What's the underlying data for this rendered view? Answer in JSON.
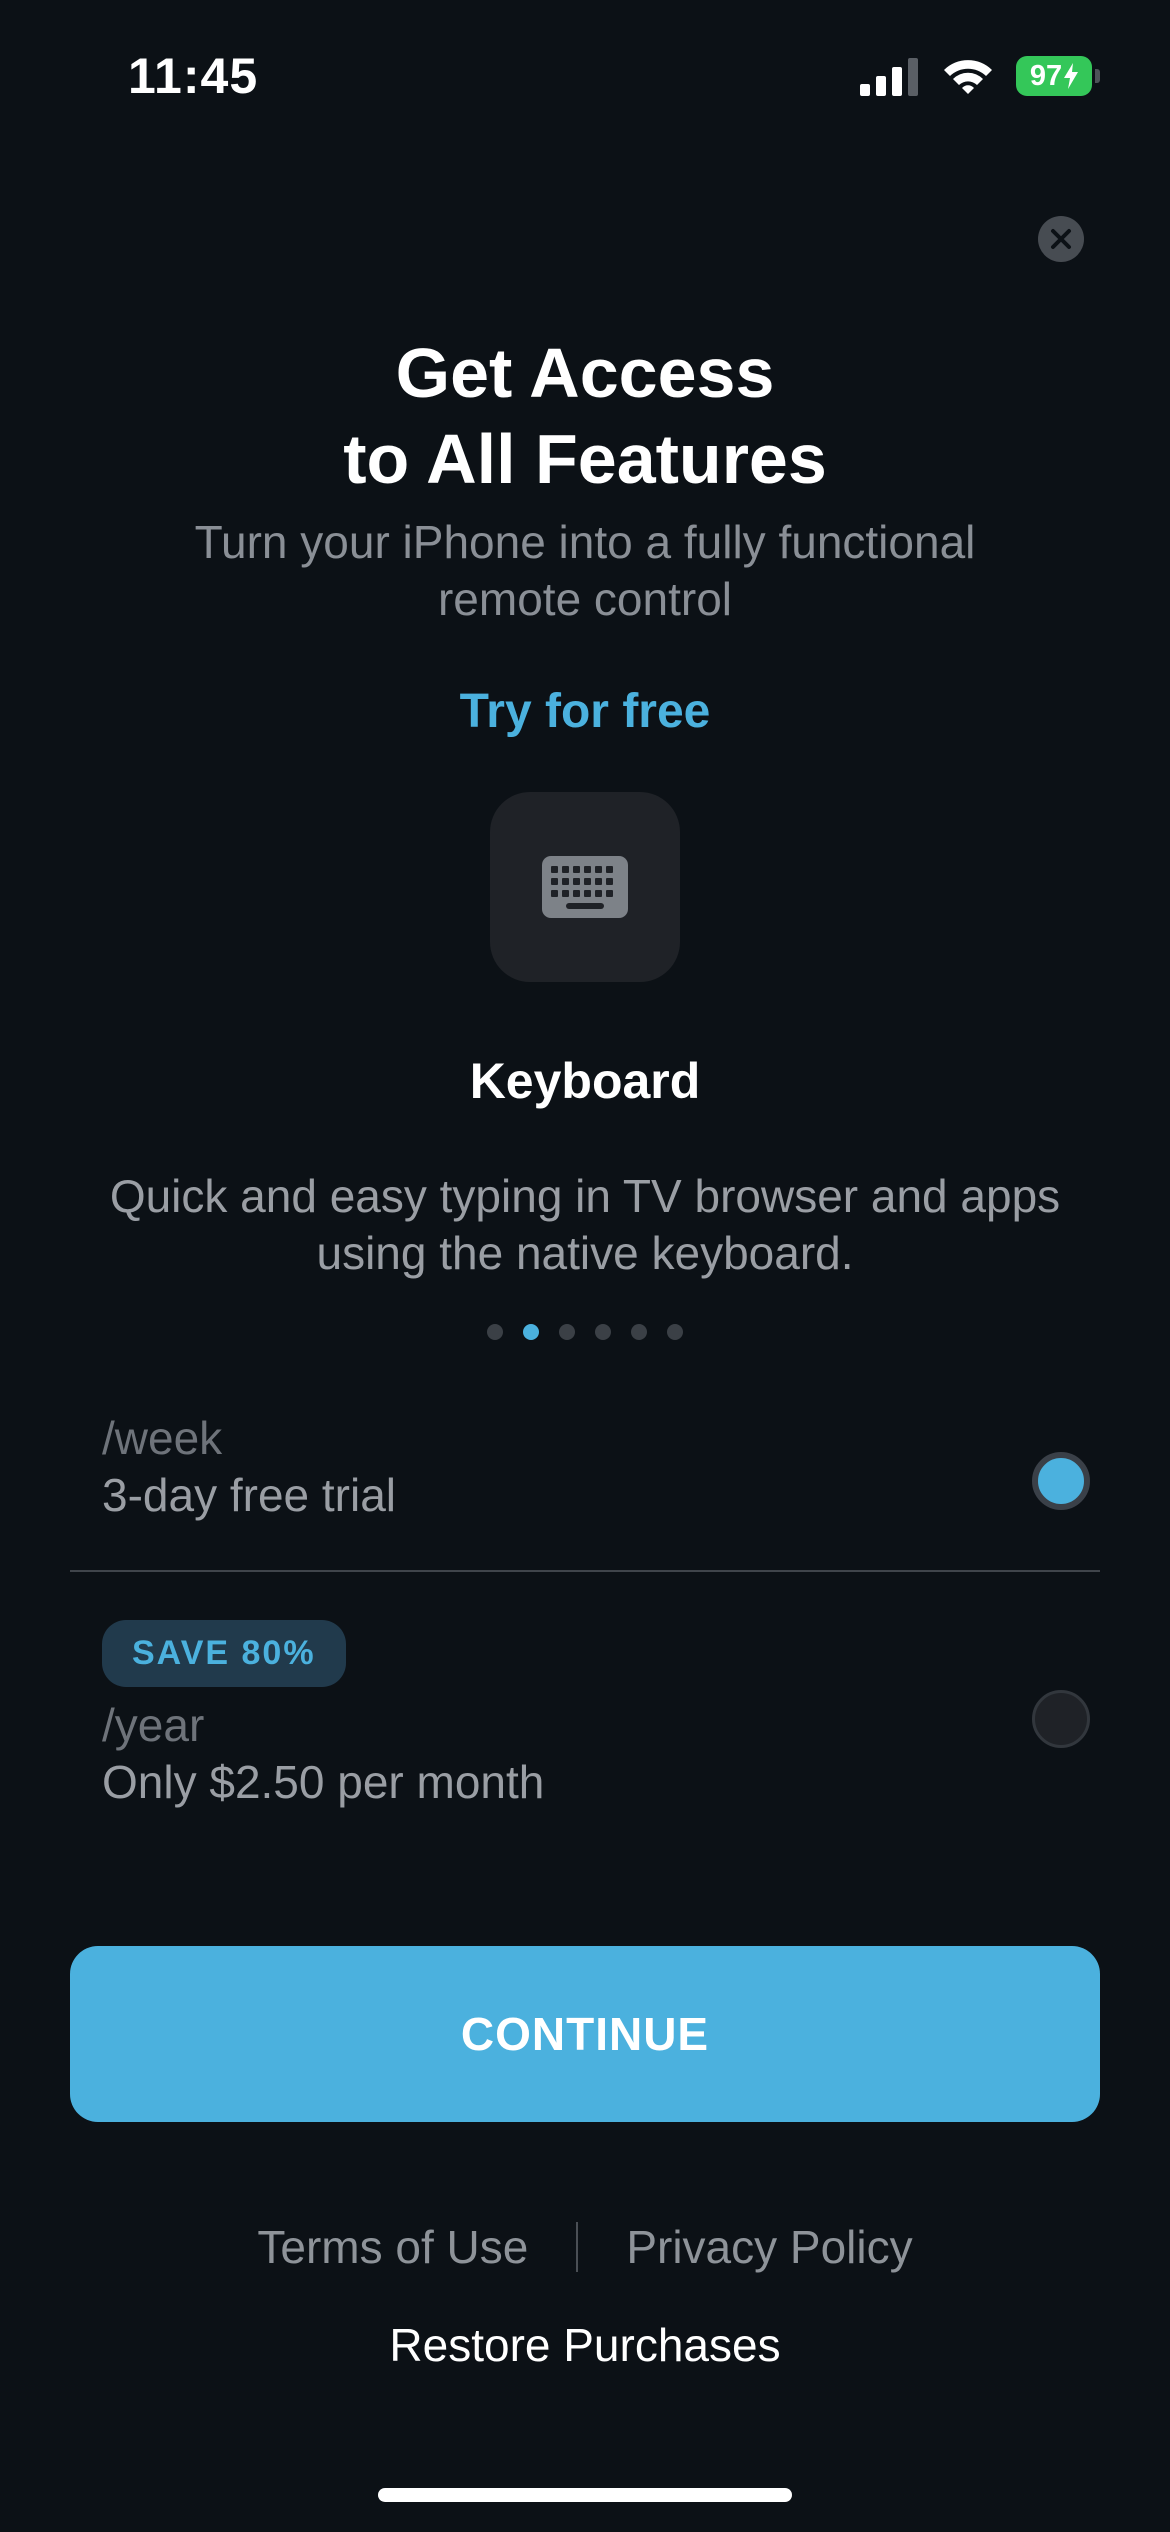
{
  "status_bar": {
    "time": "11:45",
    "battery": "97",
    "icons": [
      "cellular-signal-icon",
      "wifi-icon",
      "battery-charging-icon"
    ]
  },
  "close_icon": "close-icon",
  "headline": {
    "line1": "Get Access",
    "line2": "to All Features"
  },
  "subtitle": "Turn your iPhone into a fully functional remote control",
  "try_free": "Try for free",
  "feature": {
    "icon": "keyboard-icon",
    "title": "Keyboard",
    "description": "Quick and easy typing in TV browser and apps using the native keyboard.",
    "page_count": 6,
    "active_page": 2
  },
  "plans": [
    {
      "period": "/week",
      "detail": "3-day free trial",
      "selected": true
    },
    {
      "badge": "SAVE 80%",
      "period": "/year",
      "detail": "Only $2.50 per month",
      "selected": false
    }
  ],
  "continue_label": "CONTINUE",
  "footer": {
    "terms": "Terms of Use",
    "privacy": "Privacy Policy",
    "restore": "Restore Purchases"
  },
  "colors": {
    "background": "#0c1116",
    "accent": "#4bb1de",
    "battery": "#34c759"
  }
}
